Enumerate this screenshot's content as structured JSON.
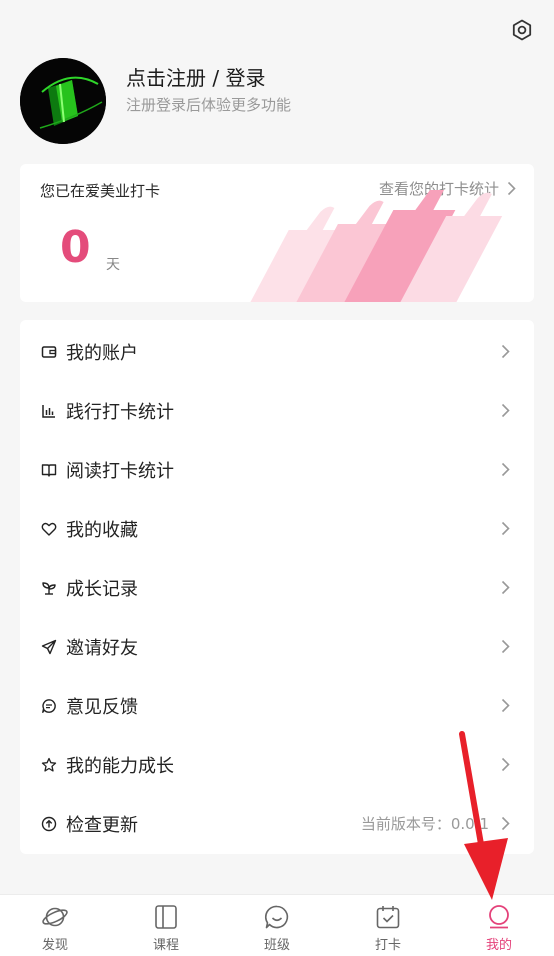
{
  "header": {
    "settings_icon": "gear-icon"
  },
  "profile": {
    "title": "点击注册 / 登录",
    "subtitle": "注册登录后体验更多功能"
  },
  "checkin": {
    "title": "您已在爱美业打卡",
    "link": "查看您的打卡统计",
    "days": "0",
    "unit": "天"
  },
  "menu": {
    "items": [
      {
        "label": "我的账户",
        "icon": "wallet-icon"
      },
      {
        "label": "践行打卡统计",
        "icon": "bar-chart-icon"
      },
      {
        "label": "阅读打卡统计",
        "icon": "book-icon"
      },
      {
        "label": "我的收藏",
        "icon": "heart-icon"
      },
      {
        "label": "成长记录",
        "icon": "sprout-icon"
      },
      {
        "label": "邀请好友",
        "icon": "paper-plane-icon"
      },
      {
        "label": "意见反馈",
        "icon": "chat-bubble-icon"
      },
      {
        "label": "我的能力成长",
        "icon": "star-icon"
      },
      {
        "label": "检查更新",
        "icon": "upload-circle-icon",
        "value": "当前版本号：0.0.1"
      }
    ]
  },
  "tabbar": {
    "tabs": [
      {
        "label": "发现",
        "icon": "planet-icon"
      },
      {
        "label": "课程",
        "icon": "book-panel-icon"
      },
      {
        "label": "班级",
        "icon": "chat-smile-icon"
      },
      {
        "label": "打卡",
        "icon": "calendar-check-icon"
      },
      {
        "label": "我的",
        "icon": "user-icon",
        "active": true
      }
    ]
  },
  "colors": {
    "accent": "#e4427a",
    "days": "#e44c7b",
    "annotation_arrow": "#e8202a"
  }
}
